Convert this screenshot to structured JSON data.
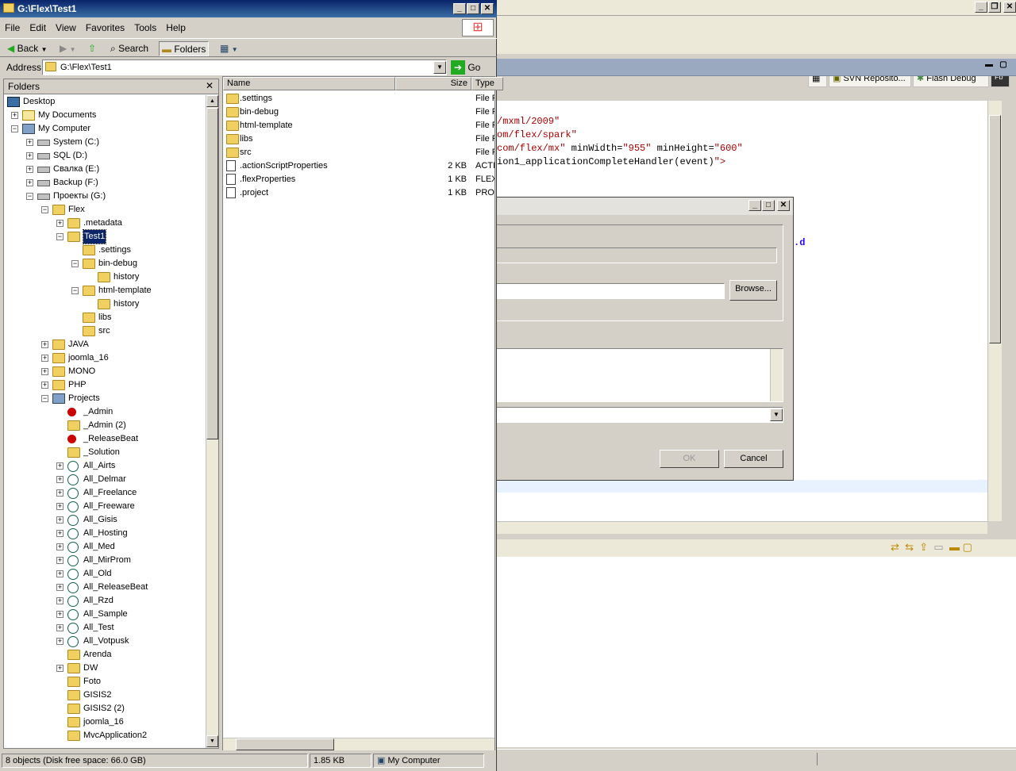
{
  "explorer": {
    "title": "G:\\Flex\\Test1",
    "menu": [
      "File",
      "Edit",
      "View",
      "Favorites",
      "Tools",
      "Help"
    ],
    "toolbar": {
      "back": "Back",
      "search": "Search",
      "folders": "Folders"
    },
    "address_label": "Address",
    "address_value": "G:\\Flex\\Test1",
    "go": "Go",
    "folders_header": "Folders",
    "tree": [
      {
        "label": "Desktop",
        "depth": 0,
        "icon": "desk",
        "exp": ""
      },
      {
        "label": "My Documents",
        "depth": 1,
        "icon": "docs",
        "exp": "+"
      },
      {
        "label": "My Computer",
        "depth": 1,
        "icon": "comp",
        "exp": "-"
      },
      {
        "label": "System (C:)",
        "depth": 2,
        "icon": "drive",
        "exp": "+"
      },
      {
        "label": "SQL (D:)",
        "depth": 2,
        "icon": "drive",
        "exp": "+"
      },
      {
        "label": "Свалка (E:)",
        "depth": 2,
        "icon": "drive",
        "exp": "+"
      },
      {
        "label": "Backup (F:)",
        "depth": 2,
        "icon": "drive",
        "exp": "+"
      },
      {
        "label": "Проекты (G:)",
        "depth": 2,
        "icon": "drive",
        "exp": "-"
      },
      {
        "label": "Flex",
        "depth": 3,
        "icon": "folder",
        "exp": "-"
      },
      {
        "label": ".metadata",
        "depth": 4,
        "icon": "folder",
        "exp": "+"
      },
      {
        "label": "Test1",
        "depth": 4,
        "icon": "folder",
        "exp": "-",
        "selected": true
      },
      {
        "label": ".settings",
        "depth": 5,
        "icon": "folder",
        "exp": ""
      },
      {
        "label": "bin-debug",
        "depth": 5,
        "icon": "folder",
        "exp": "-"
      },
      {
        "label": "history",
        "depth": 6,
        "icon": "folder",
        "exp": ""
      },
      {
        "label": "html-template",
        "depth": 5,
        "icon": "folder",
        "exp": "-"
      },
      {
        "label": "history",
        "depth": 6,
        "icon": "folder",
        "exp": ""
      },
      {
        "label": "libs",
        "depth": 5,
        "icon": "folder",
        "exp": ""
      },
      {
        "label": "src",
        "depth": 5,
        "icon": "folder",
        "exp": ""
      },
      {
        "label": "JAVA",
        "depth": 3,
        "icon": "folder",
        "exp": "+"
      },
      {
        "label": "joomla_16",
        "depth": 3,
        "icon": "folder",
        "exp": "+"
      },
      {
        "label": "MONO",
        "depth": 3,
        "icon": "folder",
        "exp": "+"
      },
      {
        "label": "PHP",
        "depth": 3,
        "icon": "folder",
        "exp": "+"
      },
      {
        "label": "Projects",
        "depth": 3,
        "icon": "comp",
        "exp": "-"
      },
      {
        "label": "_Admin",
        "depth": 4,
        "icon": "red",
        "exp": ""
      },
      {
        "label": "_Admin (2)",
        "depth": 4,
        "icon": "folder",
        "exp": ""
      },
      {
        "label": "_ReleaseBeat",
        "depth": 4,
        "icon": "red",
        "exp": ""
      },
      {
        "label": "_Solution",
        "depth": 4,
        "icon": "folder",
        "exp": ""
      },
      {
        "label": "All_Airts",
        "depth": 4,
        "icon": "globe",
        "exp": "+"
      },
      {
        "label": "All_Delmar",
        "depth": 4,
        "icon": "globe",
        "exp": "+"
      },
      {
        "label": "All_Freelance",
        "depth": 4,
        "icon": "globe",
        "exp": "+"
      },
      {
        "label": "All_Freeware",
        "depth": 4,
        "icon": "globe",
        "exp": "+"
      },
      {
        "label": "All_Gisis",
        "depth": 4,
        "icon": "globe",
        "exp": "+"
      },
      {
        "label": "All_Hosting",
        "depth": 4,
        "icon": "globe",
        "exp": "+"
      },
      {
        "label": "All_Med",
        "depth": 4,
        "icon": "globe",
        "exp": "+"
      },
      {
        "label": "All_MirProm",
        "depth": 4,
        "icon": "globe",
        "exp": "+"
      },
      {
        "label": "All_Old",
        "depth": 4,
        "icon": "globe",
        "exp": "+"
      },
      {
        "label": "All_ReleaseBeat",
        "depth": 4,
        "icon": "globe",
        "exp": "+"
      },
      {
        "label": "All_Rzd",
        "depth": 4,
        "icon": "globe",
        "exp": "+"
      },
      {
        "label": "All_Sample",
        "depth": 4,
        "icon": "globe",
        "exp": "+"
      },
      {
        "label": "All_Test",
        "depth": 4,
        "icon": "globe",
        "exp": "+"
      },
      {
        "label": "All_Votpusk",
        "depth": 4,
        "icon": "globe",
        "exp": "+"
      },
      {
        "label": "Arenda",
        "depth": 4,
        "icon": "folder",
        "exp": ""
      },
      {
        "label": "DW",
        "depth": 4,
        "icon": "folder",
        "exp": "+"
      },
      {
        "label": "Foto",
        "depth": 4,
        "icon": "folder",
        "exp": ""
      },
      {
        "label": "GISIS2",
        "depth": 4,
        "icon": "folder",
        "exp": ""
      },
      {
        "label": "GISIS2 (2)",
        "depth": 4,
        "icon": "folder",
        "exp": ""
      },
      {
        "label": "joomla_16",
        "depth": 4,
        "icon": "folder",
        "exp": ""
      },
      {
        "label": "MvcApplication2",
        "depth": 4,
        "icon": "folder",
        "exp": ""
      }
    ],
    "columns": {
      "name": "Name",
      "size": "Size",
      "type": "Type"
    },
    "files": [
      {
        "name": ".settings",
        "size": "",
        "type": "File F",
        "icon": "folder"
      },
      {
        "name": "bin-debug",
        "size": "",
        "type": "File F",
        "icon": "folder"
      },
      {
        "name": "html-template",
        "size": "",
        "type": "File F",
        "icon": "folder"
      },
      {
        "name": "libs",
        "size": "",
        "type": "File F",
        "icon": "folder"
      },
      {
        "name": "src",
        "size": "",
        "type": "File F",
        "icon": "folder"
      },
      {
        "name": ".actionScriptProperties",
        "size": "2 KB",
        "type": "ACTI",
        "icon": "file"
      },
      {
        "name": ".flexProperties",
        "size": "1 KB",
        "type": "FLEX",
        "icon": "file"
      },
      {
        "name": ".project",
        "size": "1 KB",
        "type": "PRO.",
        "icon": "file"
      }
    ],
    "status": {
      "objects": "8 objects (Disk free space: 66.0 GB)",
      "size": "1.85 KB",
      "location": "My Computer"
    }
  },
  "eclipse": {
    "perspectives": [
      "SVN Reposito...",
      "Flash Debug"
    ],
    "fb_badge": "Fb",
    "code": [
      {
        "parts": [
          {
            "t": "/mxml/2009\"",
            "c": "red"
          }
        ]
      },
      {
        "parts": [
          {
            "t": "om/flex/spark\"",
            "c": "red"
          }
        ]
      },
      {
        "parts": [
          {
            "t": "com/flex/mx\"",
            "c": "red"
          },
          {
            "t": " minWidth=",
            "c": ""
          },
          {
            "t": "\"955\"",
            "c": "red"
          },
          {
            "t": " minHeight=",
            "c": ""
          },
          {
            "t": "\"600\"",
            "c": "red"
          }
        ]
      },
      {
        "parts": [
          {
            "t": "ion1_applicationCompleteHandler(event)",
            "c": ""
          },
          {
            "t": "\">",
            "c": "red"
          }
        ]
      }
    ],
    "code_frag": ".d"
  },
  "dialog": {
    "browse": "Browse...",
    "ok": "OK",
    "cancel": "Cancel"
  }
}
